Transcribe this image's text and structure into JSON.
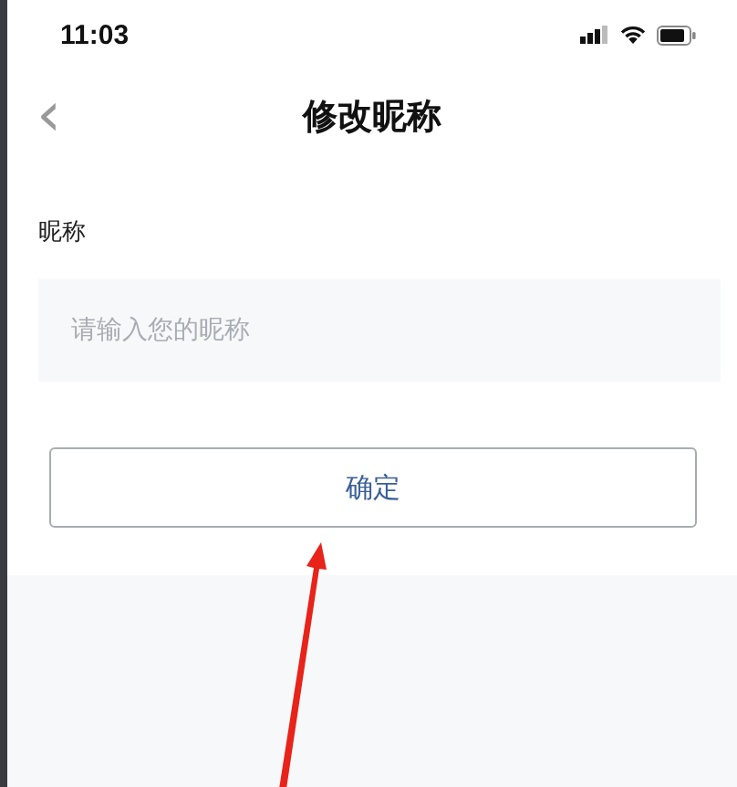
{
  "status_bar": {
    "time": "11:03"
  },
  "nav": {
    "back_icon": "‹",
    "title": "修改昵称"
  },
  "form": {
    "label": "昵称",
    "input": {
      "placeholder": "请输入您的昵称"
    },
    "button": "确定"
  }
}
